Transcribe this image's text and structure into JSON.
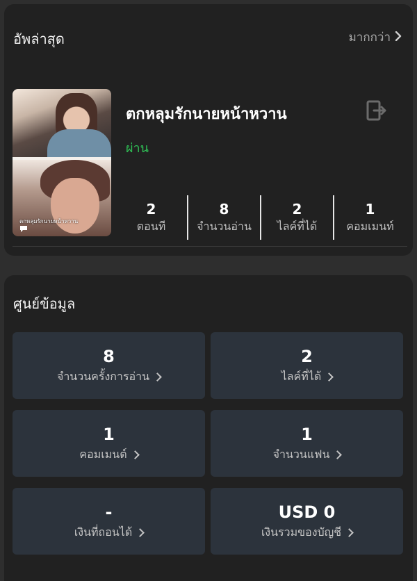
{
  "latest": {
    "title": "อัพล่าสุด",
    "more_label": "มากกว่า",
    "novel": {
      "title": "ตกหลุมรักนายหน้าหวาน",
      "status": "ผ่าน",
      "cover_caption": "ตกหลุมรักนายหน้าหวาน"
    },
    "stats": [
      {
        "value": "2",
        "label": "ตอนที"
      },
      {
        "value": "8",
        "label": "จำนวนอ่าน"
      },
      {
        "value": "2",
        "label": "ไลค์ที่ได้"
      },
      {
        "value": "1",
        "label": "คอมเมนท์"
      }
    ]
  },
  "info": {
    "title": "ศูนย์ข้อมูล",
    "tiles": [
      {
        "value": "8",
        "label": "จำนวนครั้งการอ่าน"
      },
      {
        "value": "2",
        "label": "ไลค์ที่ได้"
      },
      {
        "value": "1",
        "label": "คอมเมนต์"
      },
      {
        "value": "1",
        "label": "จำนวนแฟน"
      },
      {
        "value": "-",
        "label": "เงินที่ถอนได้"
      },
      {
        "value": "USD 0",
        "label": "เงินรวมของบัญชี"
      }
    ]
  },
  "icons": {
    "more": "chevron-right-icon",
    "exit": "exit-icon",
    "chat": "chat-bubble-icon"
  },
  "colors": {
    "background": "#2e2e2e",
    "card": "#212121",
    "tile": "#2c333c",
    "status_green": "#2fbf55"
  }
}
